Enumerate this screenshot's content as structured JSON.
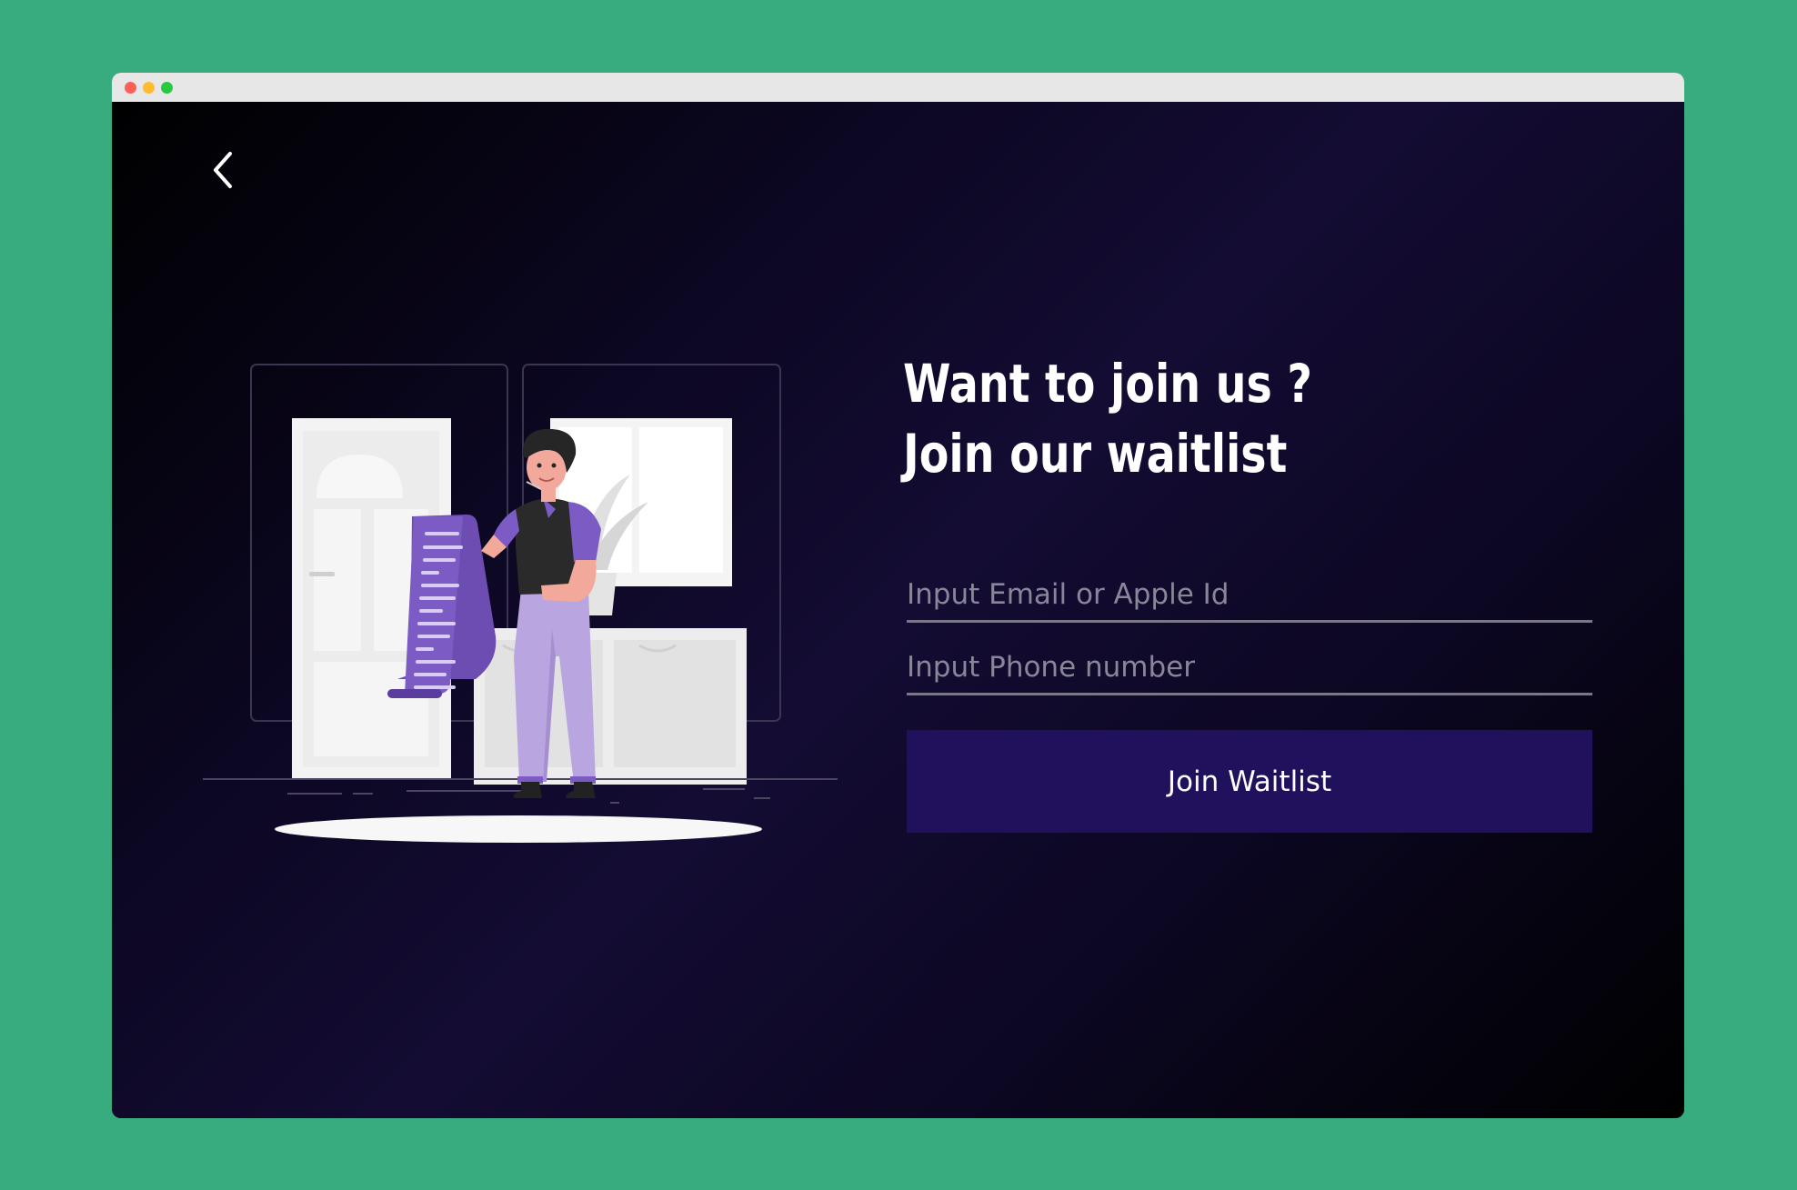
{
  "window": {
    "traffic_lights": [
      "close",
      "minimize",
      "maximize"
    ]
  },
  "nav": {
    "back_icon": "chevron-left-icon"
  },
  "hero": {
    "title_line1": "Want to join us ?",
    "title_line2": "Join our waitlist"
  },
  "form": {
    "email_placeholder": "Input Email or Apple Id",
    "email_value": "",
    "phone_placeholder": "Input Phone number",
    "phone_value": "",
    "submit_label": "Join Waitlist"
  },
  "colors": {
    "page_background": "#38ac7e",
    "button_background": "#21105c",
    "accent_purple": "#7c5cc4",
    "light_purple": "#b9a6e0"
  }
}
